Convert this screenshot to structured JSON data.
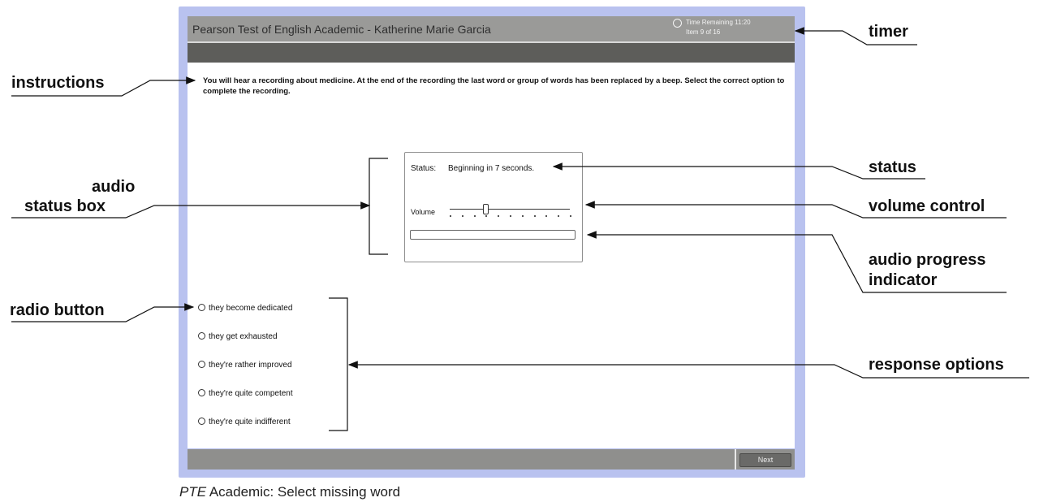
{
  "window": {
    "app_title": "Pearson Test of English Academic - Katherine Marie Garcia",
    "timer_text": "Time Remaining 11:20",
    "item_text": "Item 9 of 16",
    "next_label": "Next"
  },
  "instructions": "You will hear a recording about medicine. At the end of the recording the last word or group of words has been replaced by a beep. Select the correct option to complete the recording.",
  "audio": {
    "status_label": "Status:",
    "status_value": "Beginning in 7 seconds.",
    "volume_label": "Volume",
    "volume_level": 0.3,
    "progress": 0
  },
  "options": [
    "they become dedicated",
    "they get exhausted",
    "they're rather improved",
    "they're quite competent",
    "they're quite indifferent"
  ],
  "caption": {
    "prefix": "PTE",
    "rest": " Academic: Select missing word"
  },
  "annotations": {
    "timer": "timer",
    "instructions": "instructions",
    "status": "status",
    "audio_status_box_1": "audio",
    "audio_status_box_2": "status box",
    "volume_control": "volume control",
    "progress_1": "audio progress",
    "progress_2": "indicator",
    "radio_button": "radio button",
    "response_options": "response options"
  }
}
